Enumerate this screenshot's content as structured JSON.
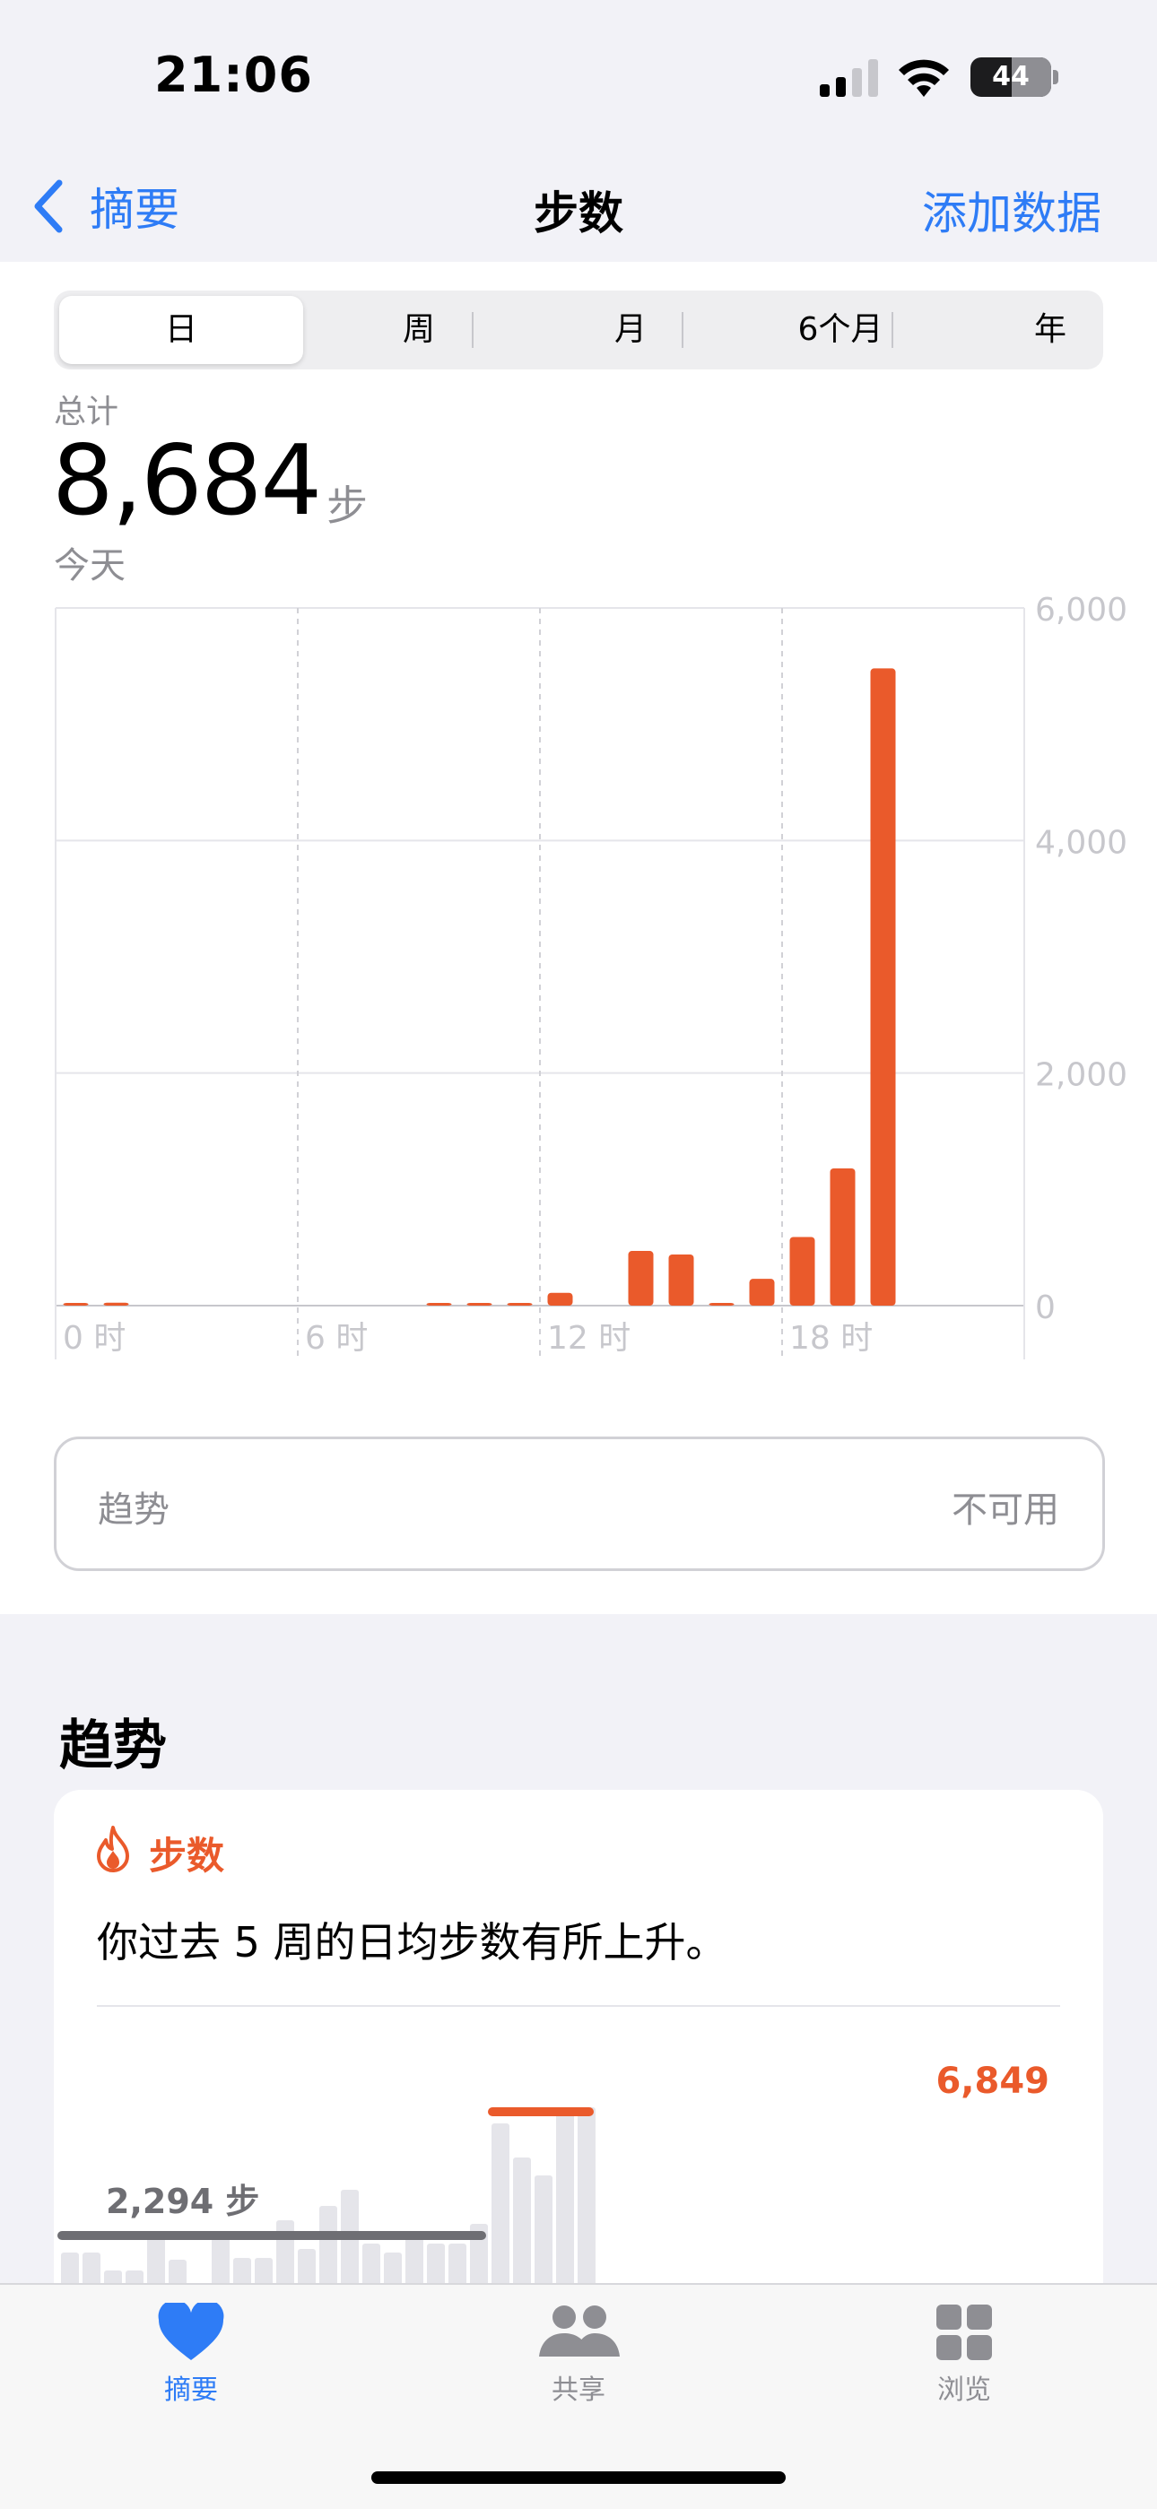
{
  "status_bar": {
    "time": "21:06",
    "battery": "44"
  },
  "nav": {
    "back_label": "摘要",
    "title": "步数",
    "action_label": "添加数据"
  },
  "segments": [
    "日",
    "周",
    "月",
    "6个月",
    "年"
  ],
  "selected_segment": "日",
  "summary": {
    "label": "总计",
    "value": "8,684",
    "unit": "步",
    "date": "今天"
  },
  "chart_data": {
    "type": "bar",
    "x_tick_labels": [
      "0 时",
      "6 时",
      "12 时",
      "18 时"
    ],
    "y_tick_labels": [
      "6,000",
      "4,000",
      "2,000",
      "0"
    ],
    "ylim": [
      0,
      6000
    ],
    "color": "#EA5A2B",
    "hours": [
      0,
      1,
      9,
      10,
      11,
      12,
      14,
      15,
      16,
      17,
      18,
      19,
      20
    ],
    "values": [
      15,
      25,
      20,
      20,
      15,
      110,
      470,
      440,
      20,
      230,
      590,
      1180,
      5480
    ]
  },
  "trend_row": {
    "label": "趋势",
    "value": "不可用"
  },
  "trends_section": {
    "title": "趋势",
    "card": {
      "category": "步数",
      "description": "你过去 5 周的日均步数有所上升。",
      "old_average_label": "2,294 步",
      "new_average_label": "6,849",
      "old_color": "#6E6E73",
      "new_color": "#EA5A2B"
    }
  },
  "tab_bar": {
    "items": [
      {
        "label": "摘要"
      },
      {
        "label": "共享"
      },
      {
        "label": "浏览"
      }
    ]
  }
}
